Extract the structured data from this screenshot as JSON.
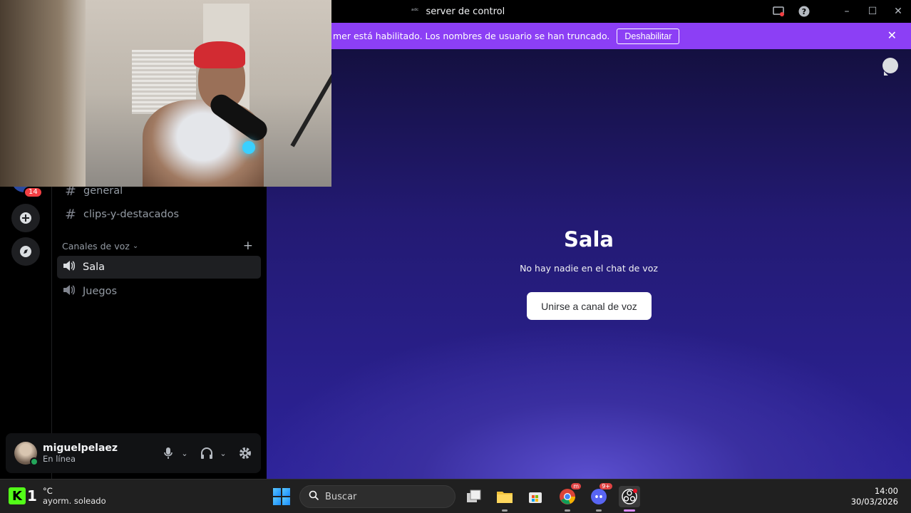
{
  "window": {
    "title": "server de control",
    "logo_text": "ᵃᵈᶜ"
  },
  "notice": {
    "message": "mer está habilitado. Los nombres de usuario se han truncado.",
    "button_label": "Deshabilitar"
  },
  "rail": {
    "badge": "14"
  },
  "channels": {
    "text": [
      {
        "label": "general"
      },
      {
        "label": "clips-y-destacados"
      }
    ],
    "voice_category": "Canales de voz",
    "voice": [
      {
        "label": "Sala",
        "active": true
      },
      {
        "label": "Juegos",
        "active": false
      }
    ]
  },
  "user": {
    "name": "miguelpelaez",
    "status": "En línea"
  },
  "voice_room": {
    "title": "Sala",
    "subtitle": "No hay nadie en el chat de voz",
    "join_label": "Unirse a canal de voz"
  },
  "taskbar": {
    "kick_letter": "K",
    "kick_count": "1",
    "temp": "°C",
    "weather": "ayorm. soleado",
    "search_placeholder": "Buscar",
    "chrome_badge": "m",
    "discord_badge": "9+",
    "time": "14:00",
    "date": "30/03/2026"
  },
  "colors": {
    "notice_bg": "#8c3ff5",
    "status_online": "#23a55a",
    "badge_red": "#f23f43"
  }
}
